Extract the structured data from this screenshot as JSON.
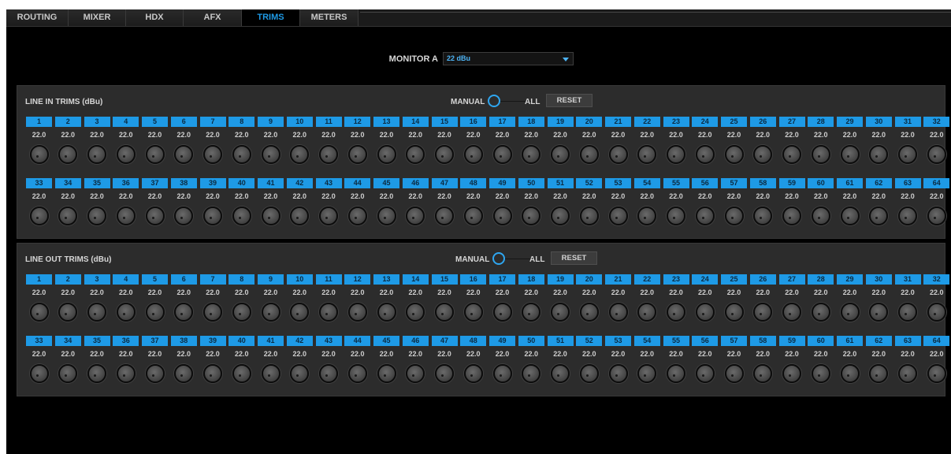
{
  "tabs": [
    {
      "label": "ROUTING",
      "active": false
    },
    {
      "label": "MIXER",
      "active": false
    },
    {
      "label": "HDX",
      "active": false
    },
    {
      "label": "AFX",
      "active": false
    },
    {
      "label": "TRIMS",
      "active": true
    },
    {
      "label": "METERS",
      "active": false
    }
  ],
  "monitor": {
    "label": "MONITOR A",
    "value": "22 dBu"
  },
  "line_in": {
    "title": "LINE IN TRIMS (dBu)",
    "manual_label": "MANUAL",
    "all_label": "ALL",
    "reset_label": "RESET",
    "mode": "MANUAL",
    "channels": [
      "1",
      "2",
      "3",
      "4",
      "5",
      "6",
      "7",
      "8",
      "9",
      "10",
      "11",
      "12",
      "13",
      "14",
      "15",
      "16",
      "17",
      "18",
      "19",
      "20",
      "21",
      "22",
      "23",
      "24",
      "25",
      "26",
      "27",
      "28",
      "29",
      "30",
      "31",
      "32",
      "33",
      "34",
      "35",
      "36",
      "37",
      "38",
      "39",
      "40",
      "41",
      "42",
      "43",
      "44",
      "45",
      "46",
      "47",
      "48",
      "49",
      "50",
      "51",
      "52",
      "53",
      "54",
      "55",
      "56",
      "57",
      "58",
      "59",
      "60",
      "61",
      "62",
      "63",
      "64"
    ],
    "values": [
      "22.0",
      "22.0",
      "22.0",
      "22.0",
      "22.0",
      "22.0",
      "22.0",
      "22.0",
      "22.0",
      "22.0",
      "22.0",
      "22.0",
      "22.0",
      "22.0",
      "22.0",
      "22.0",
      "22.0",
      "22.0",
      "22.0",
      "22.0",
      "22.0",
      "22.0",
      "22.0",
      "22.0",
      "22.0",
      "22.0",
      "22.0",
      "22.0",
      "22.0",
      "22.0",
      "22.0",
      "22.0",
      "22.0",
      "22.0",
      "22.0",
      "22.0",
      "22.0",
      "22.0",
      "22.0",
      "22.0",
      "22.0",
      "22.0",
      "22.0",
      "22.0",
      "22.0",
      "22.0",
      "22.0",
      "22.0",
      "22.0",
      "22.0",
      "22.0",
      "22.0",
      "22.0",
      "22.0",
      "22.0",
      "22.0",
      "22.0",
      "22.0",
      "22.0",
      "22.0",
      "22.0",
      "22.0",
      "22.0",
      "22.0"
    ]
  },
  "line_out": {
    "title": "LINE OUT TRIMS (dBu)",
    "manual_label": "MANUAL",
    "all_label": "ALL",
    "reset_label": "RESET",
    "mode": "MANUAL",
    "channels": [
      "1",
      "2",
      "3",
      "4",
      "5",
      "6",
      "7",
      "8",
      "9",
      "10",
      "11",
      "12",
      "13",
      "14",
      "15",
      "16",
      "17",
      "18",
      "19",
      "20",
      "21",
      "22",
      "23",
      "24",
      "25",
      "26",
      "27",
      "28",
      "29",
      "30",
      "31",
      "32",
      "33",
      "34",
      "35",
      "36",
      "37",
      "38",
      "39",
      "40",
      "41",
      "42",
      "43",
      "44",
      "45",
      "46",
      "47",
      "48",
      "49",
      "50",
      "51",
      "52",
      "53",
      "54",
      "55",
      "56",
      "57",
      "58",
      "59",
      "60",
      "61",
      "62",
      "63",
      "64"
    ],
    "values": [
      "22.0",
      "22.0",
      "22.0",
      "22.0",
      "22.0",
      "22.0",
      "22.0",
      "22.0",
      "22.0",
      "22.0",
      "22.0",
      "22.0",
      "22.0",
      "22.0",
      "22.0",
      "22.0",
      "22.0",
      "22.0",
      "22.0",
      "22.0",
      "22.0",
      "22.0",
      "22.0",
      "22.0",
      "22.0",
      "22.0",
      "22.0",
      "22.0",
      "22.0",
      "22.0",
      "22.0",
      "22.0",
      "22.0",
      "22.0",
      "22.0",
      "22.0",
      "22.0",
      "22.0",
      "22.0",
      "22.0",
      "22.0",
      "22.0",
      "22.0",
      "22.0",
      "22.0",
      "22.0",
      "22.0",
      "22.0",
      "22.0",
      "22.0",
      "22.0",
      "22.0",
      "22.0",
      "22.0",
      "22.0",
      "22.0",
      "22.0",
      "22.0",
      "22.0",
      "22.0",
      "22.0",
      "22.0",
      "22.0",
      "22.0"
    ]
  },
  "colors": {
    "accent": "#1e9ae6",
    "background": "#000000",
    "panel": "#2c2c2c"
  },
  "icons": {
    "dropdown": "chevron-down-icon",
    "knob": "trim-knob-icon",
    "toggle": "toggle-switch-icon"
  }
}
